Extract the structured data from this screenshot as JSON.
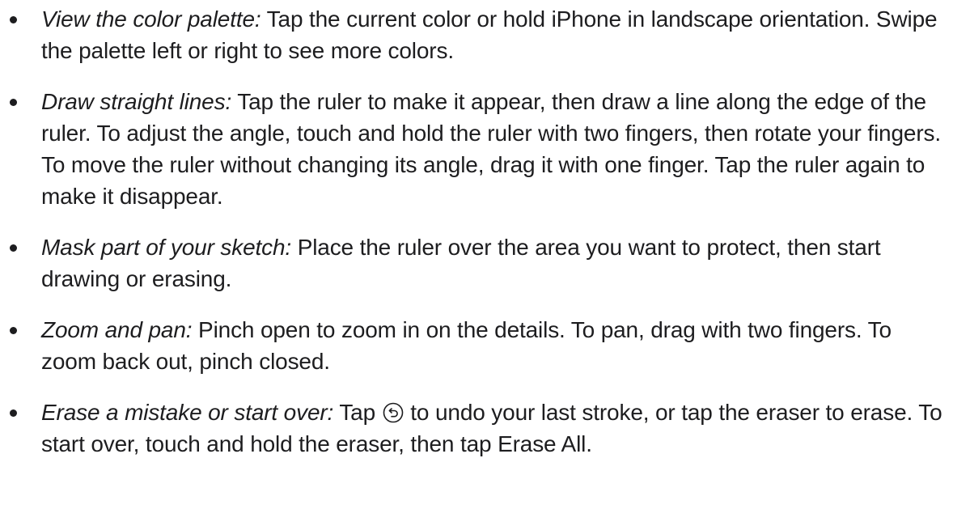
{
  "items": [
    {
      "term": "View the color palette:",
      "text": "Tap the current color or hold iPhone in landscape orientation. Swipe the palette left or right to see more colors."
    },
    {
      "term": "Draw straight lines:",
      "text": "Tap the ruler to make it appear, then draw a line along the edge of the ruler. To adjust the angle, touch and hold the ruler with two fingers, then rotate your fingers. To move the ruler without changing its angle, drag it with one finger. Tap the ruler again to make it disappear."
    },
    {
      "term": "Mask part of your sketch:",
      "text": "Place the ruler over the area you want to protect, then start drawing or erasing."
    },
    {
      "term": "Zoom and pan:",
      "text": "Pinch open to zoom in on the details. To pan, drag with two fingers. To zoom back out, pinch closed."
    },
    {
      "term": "Erase a mistake or start over:",
      "text_before_icon": "Tap",
      "icon": "undo-icon",
      "text_after_icon": "to undo your last stroke, or tap the eraser to erase. To start over, touch and hold the eraser, then tap Erase All."
    }
  ]
}
